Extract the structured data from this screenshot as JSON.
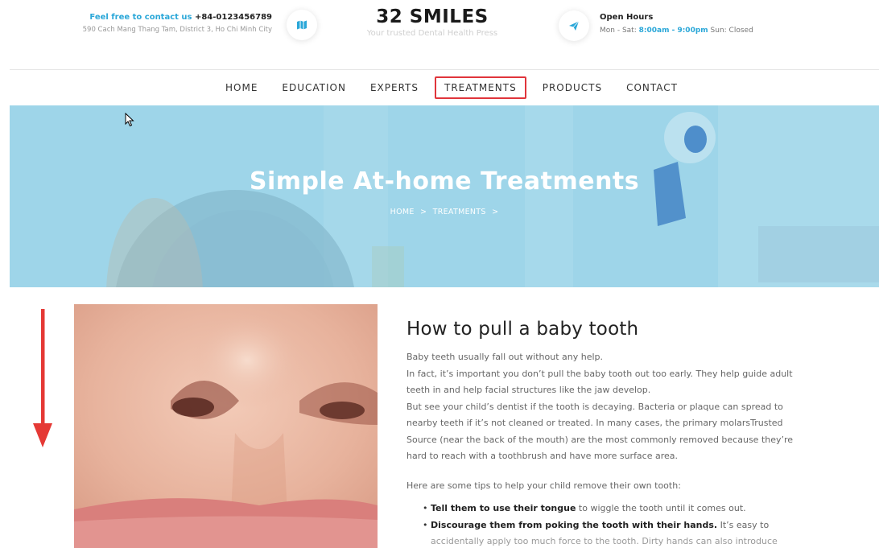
{
  "header": {
    "contact_label": "Feel free to contact us",
    "contact_phone": "+84-0123456789",
    "address": "590 Cach Mang Thang Tam, District 3, Ho Chi Minh City",
    "brand_title": "32 SMILES",
    "brand_tagline": "Your trusted Dental Health Press",
    "hours_title": "Open Hours",
    "hours_prefix": "Mon - Sat:",
    "hours_time": "8:00am - 9:00pm",
    "hours_suffix": "Sun: Closed"
  },
  "nav": {
    "items": [
      "HOME",
      "EDUCATION",
      "EXPERTS",
      "TREATMENTS",
      "PRODUCTS",
      "CONTACT"
    ],
    "active": "TREATMENTS"
  },
  "hero": {
    "title": "Simple At-home Treatments",
    "crumb_home": "HOME",
    "crumb_sep": ">",
    "crumb_current": "TREATMENTS"
  },
  "article": {
    "title": "How to pull a baby tooth",
    "p1": "Baby teeth usually fall out without any help.",
    "p2": "In fact, it’s important you don’t pull the baby tooth out too early. They help guide adult teeth in and help facial structures like the jaw develop.",
    "p3": "But see your child’s dentist if the tooth is decaying. Bacteria or plaque can spread to nearby teeth if it’s not cleaned or treated. In many cases, the primary molarsTrusted Source (near the back of the mouth) are the most commonly removed because they’re hard to reach with a toothbrush and have more surface area.",
    "p4": "Here are some tips to help your child remove their own tooth:",
    "tips": [
      {
        "bold": "Tell them to use their tongue",
        "rest": " to wiggle the tooth until it comes out."
      },
      {
        "bold": "Discourage them from poking the tooth with their hands.",
        "rest": " It’s easy to"
      }
    ],
    "cutoff_line": "accidentally apply too much force to the tooth. Dirty hands can also introduce"
  },
  "colors": {
    "accent": "#2aa7d8",
    "active_border": "#e0353b",
    "annotation_arrow": "#e53935"
  },
  "icons": {
    "contact_circle": "map-icon",
    "hours_circle": "paper-plane-icon",
    "cursor": "mouse-pointer-icon"
  }
}
